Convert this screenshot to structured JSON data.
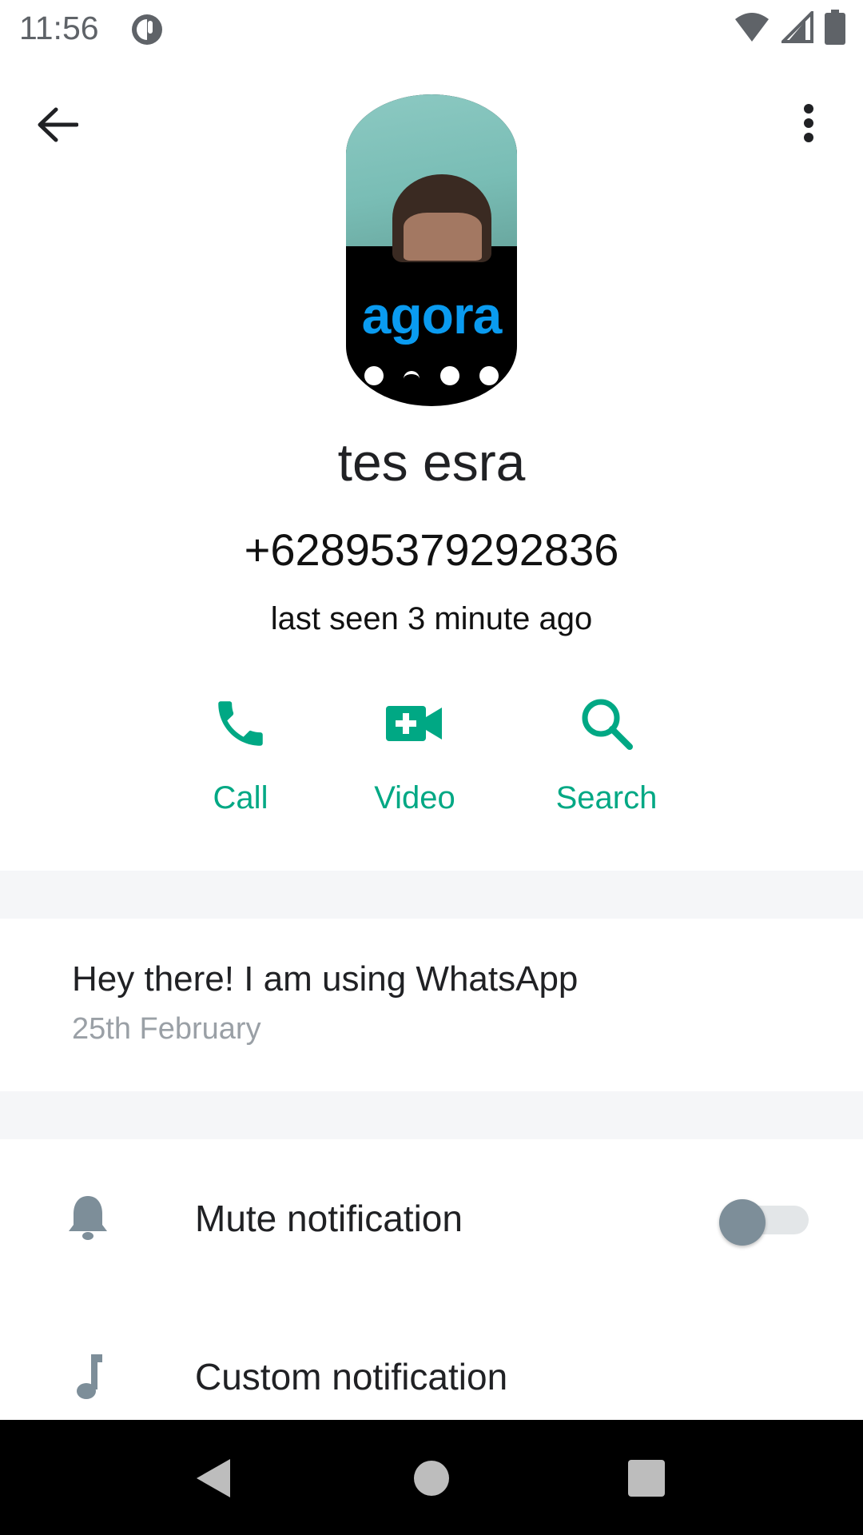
{
  "status_bar": {
    "time": "11:56"
  },
  "avatar": {
    "logo_text": "agora"
  },
  "contact": {
    "name": "tes esra",
    "phone": "+628953792928​36",
    "last_seen": "last seen 3 minute ago"
  },
  "actions": [
    {
      "label": "Call",
      "icon": "phone-icon"
    },
    {
      "label": "Video",
      "icon": "video-call-icon"
    },
    {
      "label": "Search",
      "icon": "search-icon"
    }
  ],
  "about": {
    "text": "Hey there! I am using WhatsApp",
    "date": "25th February"
  },
  "settings": {
    "mute_label": "Mute notification",
    "mute_enabled": false,
    "custom_label": "Custom notification"
  },
  "colors": {
    "accent": "#00a884",
    "band": "#f5f6f8",
    "icon_gray": "#7d8e99"
  }
}
